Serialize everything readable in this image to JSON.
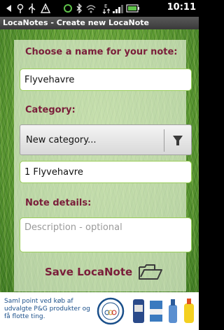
{
  "status_bar": {
    "time": "10:11",
    "icons": [
      "back-arrow-icon",
      "location-icon",
      "usb-icon",
      "warning-icon",
      "sync-icon",
      "bluetooth-icon",
      "wifi-icon",
      "data-icon",
      "signal-icon",
      "battery-icon"
    ]
  },
  "title_bar": {
    "title": "LocaNotes - Create new LocaNote"
  },
  "form": {
    "name_label": "Choose a name for your note:",
    "name_value": "Flyvehavre",
    "category_label": "Category:",
    "category_selected": "New category...",
    "new_category_value": "1 Flyvehavre",
    "details_label": "Note details:",
    "details_placeholder": "Description - optional",
    "save_label": "Save LocaNote"
  },
  "ad": {
    "text": "Saml point ved køb af udvalgte P&G produkter og få flotte ting."
  },
  "colors": {
    "label": "#7a1e3a",
    "field_border": "#9acd5a",
    "grass": "#5d9a32"
  }
}
